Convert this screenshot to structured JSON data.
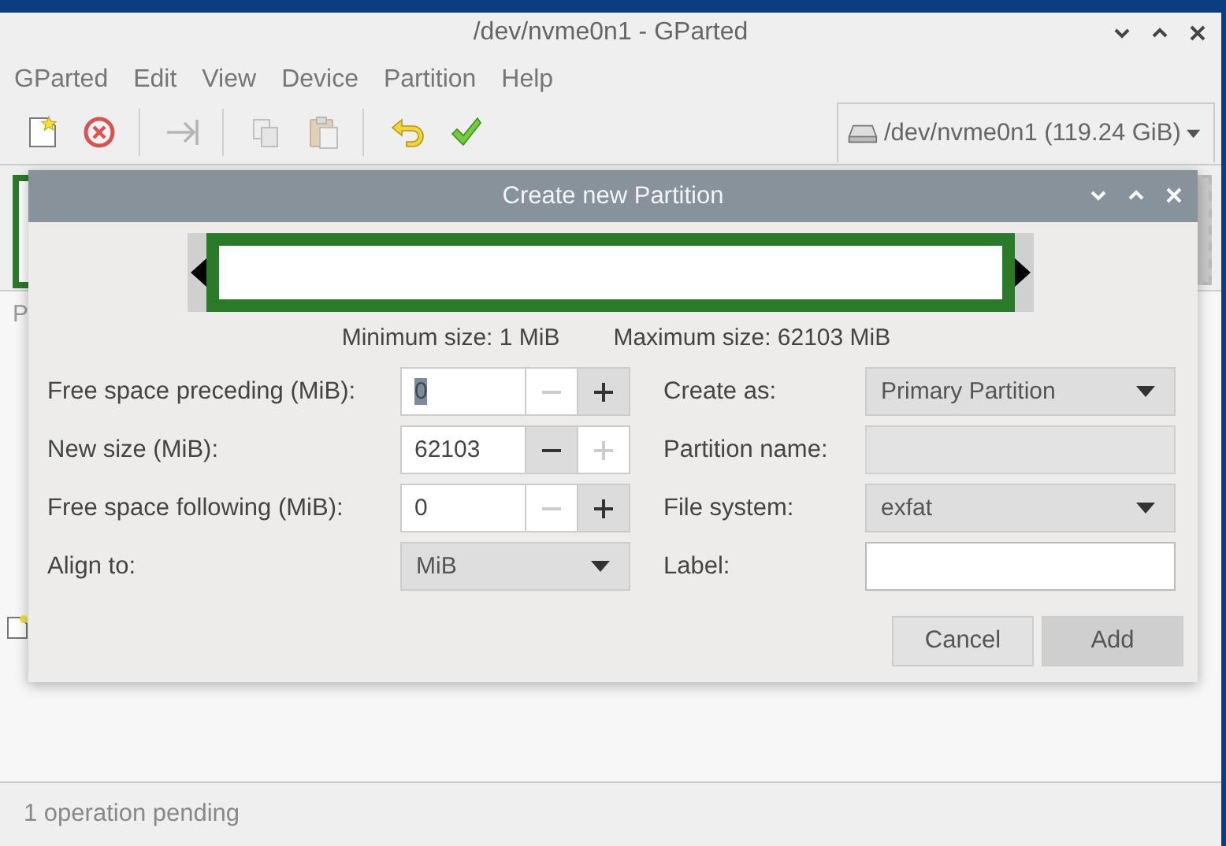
{
  "window": {
    "title": "/dev/nvme0n1 - GParted"
  },
  "menu": [
    "GParted",
    "Edit",
    "View",
    "Device",
    "Partition",
    "Help"
  ],
  "toolbar": [
    {
      "kind": "new",
      "disabled": false
    },
    {
      "kind": "delete",
      "disabled": false
    },
    {
      "kind": "separator"
    },
    {
      "kind": "resize",
      "disabled": true
    },
    {
      "kind": "separator"
    },
    {
      "kind": "copy",
      "disabled": true
    },
    {
      "kind": "paste",
      "disabled": true
    },
    {
      "kind": "separator"
    },
    {
      "kind": "undo",
      "disabled": false
    },
    {
      "kind": "apply",
      "disabled": false
    }
  ],
  "device_selector": {
    "label": "/dev/nvme0n1 (119.24 GiB)"
  },
  "partition_list": {
    "column_1": "P"
  },
  "dialog": {
    "title": "Create new Partition",
    "min_size": "Minimum size: 1 MiB",
    "max_size": "Maximum size: 62103 MiB",
    "left_fields": [
      {
        "kind": "spin",
        "label": "Free space preceding (MiB):",
        "value": "0",
        "value_selected": true,
        "minus_disabled": true,
        "plus_disabled": false
      },
      {
        "kind": "spin",
        "label": "New size (MiB):",
        "value": "62103",
        "value_selected": false,
        "minus_disabled": false,
        "plus_disabled": true
      },
      {
        "kind": "spin",
        "label": "Free space following (MiB):",
        "value": "0",
        "value_selected": false,
        "minus_disabled": true,
        "plus_disabled": false
      },
      {
        "kind": "combo",
        "label": "Align to:",
        "value": "MiB"
      }
    ],
    "right_fields": [
      {
        "kind": "combo",
        "label": "Create as:",
        "value": "Primary Partition"
      },
      {
        "kind": "entry",
        "label": "Partition name:",
        "disabled": true
      },
      {
        "kind": "combo",
        "label": "File system:",
        "value": "exfat"
      },
      {
        "kind": "entry",
        "label": "Label:",
        "disabled": false
      }
    ],
    "buttons": [
      {
        "label": "Cancel",
        "highlighted": false
      },
      {
        "label": "Add",
        "highlighted": true
      }
    ]
  },
  "status_bar": {
    "text": "1 operation pending"
  }
}
